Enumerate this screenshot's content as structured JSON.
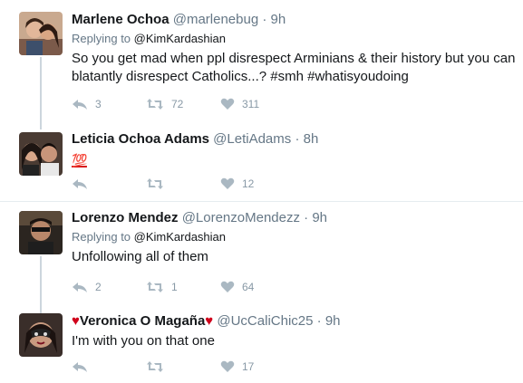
{
  "tweets": [
    {
      "name": "Marlene Ochoa",
      "handle": "@marlenebug",
      "dot": "·",
      "time": "9h",
      "replying_prefix": "Replying to ",
      "replying_to": "@KimKardashian",
      "text": "So you get mad when ppl disrespect Arminians & their history but you can blatantly disrespect Catholics...? #smh #whatisyoudoing",
      "replies": "3",
      "retweets": "72",
      "likes": "311"
    },
    {
      "name": "Leticia Ochoa Adams",
      "handle": "@LetiAdams",
      "dot": "·",
      "time": "8h",
      "text": "💯",
      "replies": "",
      "retweets": "",
      "likes": "12"
    },
    {
      "name": "Lorenzo Mendez",
      "handle": "@LorenzoMendezz",
      "dot": "·",
      "time": "9h",
      "replying_prefix": "Replying to ",
      "replying_to": "@KimKardashian",
      "text": "Unfollowing all of them",
      "replies": "2",
      "retweets": "1",
      "likes": "64"
    },
    {
      "name_heart_left": "♥",
      "name": "Veronica O Magaña",
      "name_heart_right": "♥",
      "handle": "@UcCaliChic25",
      "dot": "·",
      "time": "9h",
      "text": "I'm with you on that one",
      "replies": "",
      "retweets": "",
      "likes": "17"
    }
  ],
  "icons": {
    "reply": "reply-icon",
    "retweet": "retweet-icon",
    "like": "heart-icon"
  },
  "colors": {
    "text": "#14171a",
    "secondary": "#657786",
    "action_icon": "#aab8c2",
    "thread_line": "#ccd6dd",
    "divider": "#e6ecf0",
    "heart_emoji": "#d0021b"
  }
}
